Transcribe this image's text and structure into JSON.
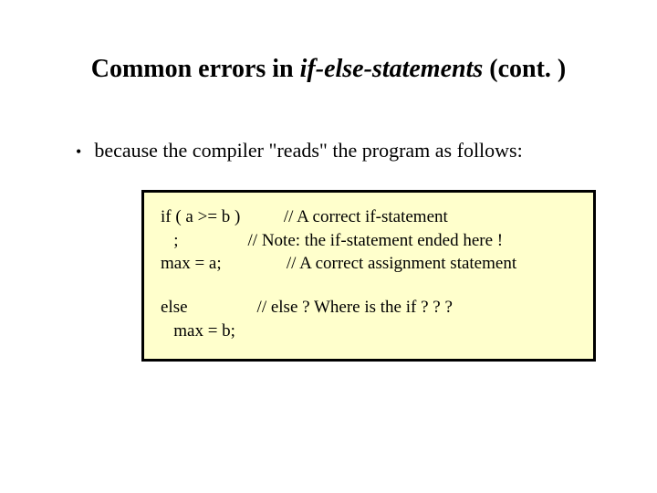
{
  "title_pre": "Common errors in ",
  "title_italic": "if-else-statements",
  "title_post": " (cont. )",
  "bullet_text": "because the compiler \"reads\" the program as follows:",
  "code": {
    "l1": "if ( a >= b )          // A correct if-statement",
    "l2": "   ;                // Note: the if-statement ended here !",
    "l3": "max = a;               // A correct assignment statement",
    "l4": "else                // else ? Where is the if ? ? ?",
    "l5": "   max = b;"
  }
}
